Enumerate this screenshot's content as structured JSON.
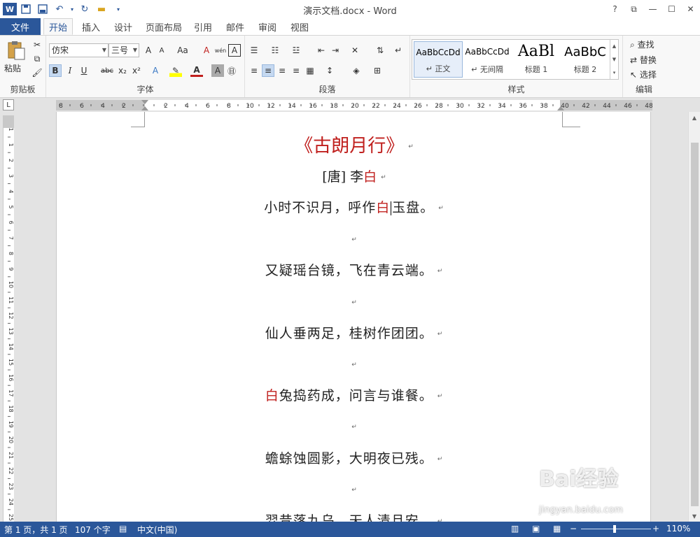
{
  "window": {
    "title": "演示文档.docx - Word",
    "app_icon": "W",
    "controls": [
      "?",
      "⧉",
      "—",
      "☐",
      "✕"
    ]
  },
  "qat": {
    "icons": [
      "save-icon",
      "save-as-icon",
      "undo-icon",
      "redo-icon",
      "open-icon",
      "customize-icon"
    ]
  },
  "tabs": {
    "file": "文件",
    "items": [
      "开始",
      "插入",
      "设计",
      "页面布局",
      "引用",
      "邮件",
      "审阅",
      "视图"
    ],
    "active": "开始"
  },
  "ribbon": {
    "clipboard": {
      "paste": "粘贴",
      "label": "剪贴板"
    },
    "font": {
      "name": "仿宋",
      "size": "三号",
      "label": "字体",
      "bold": "B",
      "italic": "I",
      "underline": "U",
      "strike": "abc",
      "sub": "x₂",
      "sup": "x²",
      "grow": "A",
      "shrink": "A",
      "case": "Aa",
      "clear": "A",
      "phonetic": "wén",
      "border": "A",
      "font_color": "A",
      "char_shade": "A",
      "enclose": "㊐"
    },
    "paragraph": {
      "label": "段落"
    },
    "styles": {
      "label": "样式",
      "items": [
        {
          "sample": "AaBbCcDd",
          "name": "↵ 正文"
        },
        {
          "sample": "AaBbCcDd",
          "name": "↵ 无间隔"
        },
        {
          "sample": "AaBl",
          "name": "标题 1"
        },
        {
          "sample": "AaBbC",
          "name": "标题 2"
        }
      ]
    },
    "editing": {
      "label": "编辑",
      "find": "查找",
      "replace": "替换",
      "select": "选择"
    }
  },
  "ruler": {
    "corner": "L",
    "left_labels": [
      "8",
      "6",
      "4",
      "2"
    ],
    "right_labels": [
      "2",
      "4",
      "6",
      "8",
      "10",
      "12",
      "14",
      "16",
      "18",
      "20",
      "22",
      "24",
      "26",
      "28",
      "30",
      "32",
      "34",
      "36",
      "38",
      "40",
      "42",
      "44",
      "46",
      "48"
    ],
    "vertical_labels": [
      "1",
      "1",
      "2",
      "3",
      "4",
      "5",
      "6",
      "7",
      "8",
      "9",
      "10",
      "11",
      "12",
      "13",
      "14",
      "15",
      "16",
      "17",
      "18",
      "19",
      "20",
      "21",
      "22",
      "23",
      "24",
      "25"
    ]
  },
  "document": {
    "title": "《古朗月行》",
    "author_prefix": "[唐] 李",
    "author_highlight": "白",
    "verses": [
      {
        "pre": "小时不识月，呼作",
        "red": "白",
        "post": "玉盘。"
      },
      {
        "pre": "又疑瑶台镜，飞在青云端。",
        "red": "",
        "post": ""
      },
      {
        "pre": "仙人垂两足，桂树作团团。",
        "red": "",
        "post": ""
      },
      {
        "pre": "",
        "red": "白",
        "post": "兔捣药成，问言与谁餐。"
      },
      {
        "pre": "蟾蜍蚀圆影，大明夜已残。",
        "red": "",
        "post": ""
      },
      {
        "pre": "羿昔落九乌，天人清且安。",
        "red": "",
        "post": ""
      }
    ],
    "para_mark": "↵"
  },
  "status": {
    "page": "第 1 页，共 1 页",
    "words": "107 个字",
    "language": "中文(中国)",
    "zoom": "110%",
    "zoom_level": 0.46
  },
  "watermark": {
    "brand": "Bai经验",
    "url": "jingyan.baidu.com"
  },
  "colors": {
    "accent": "#2b579a",
    "title_red": "#c0201e"
  }
}
